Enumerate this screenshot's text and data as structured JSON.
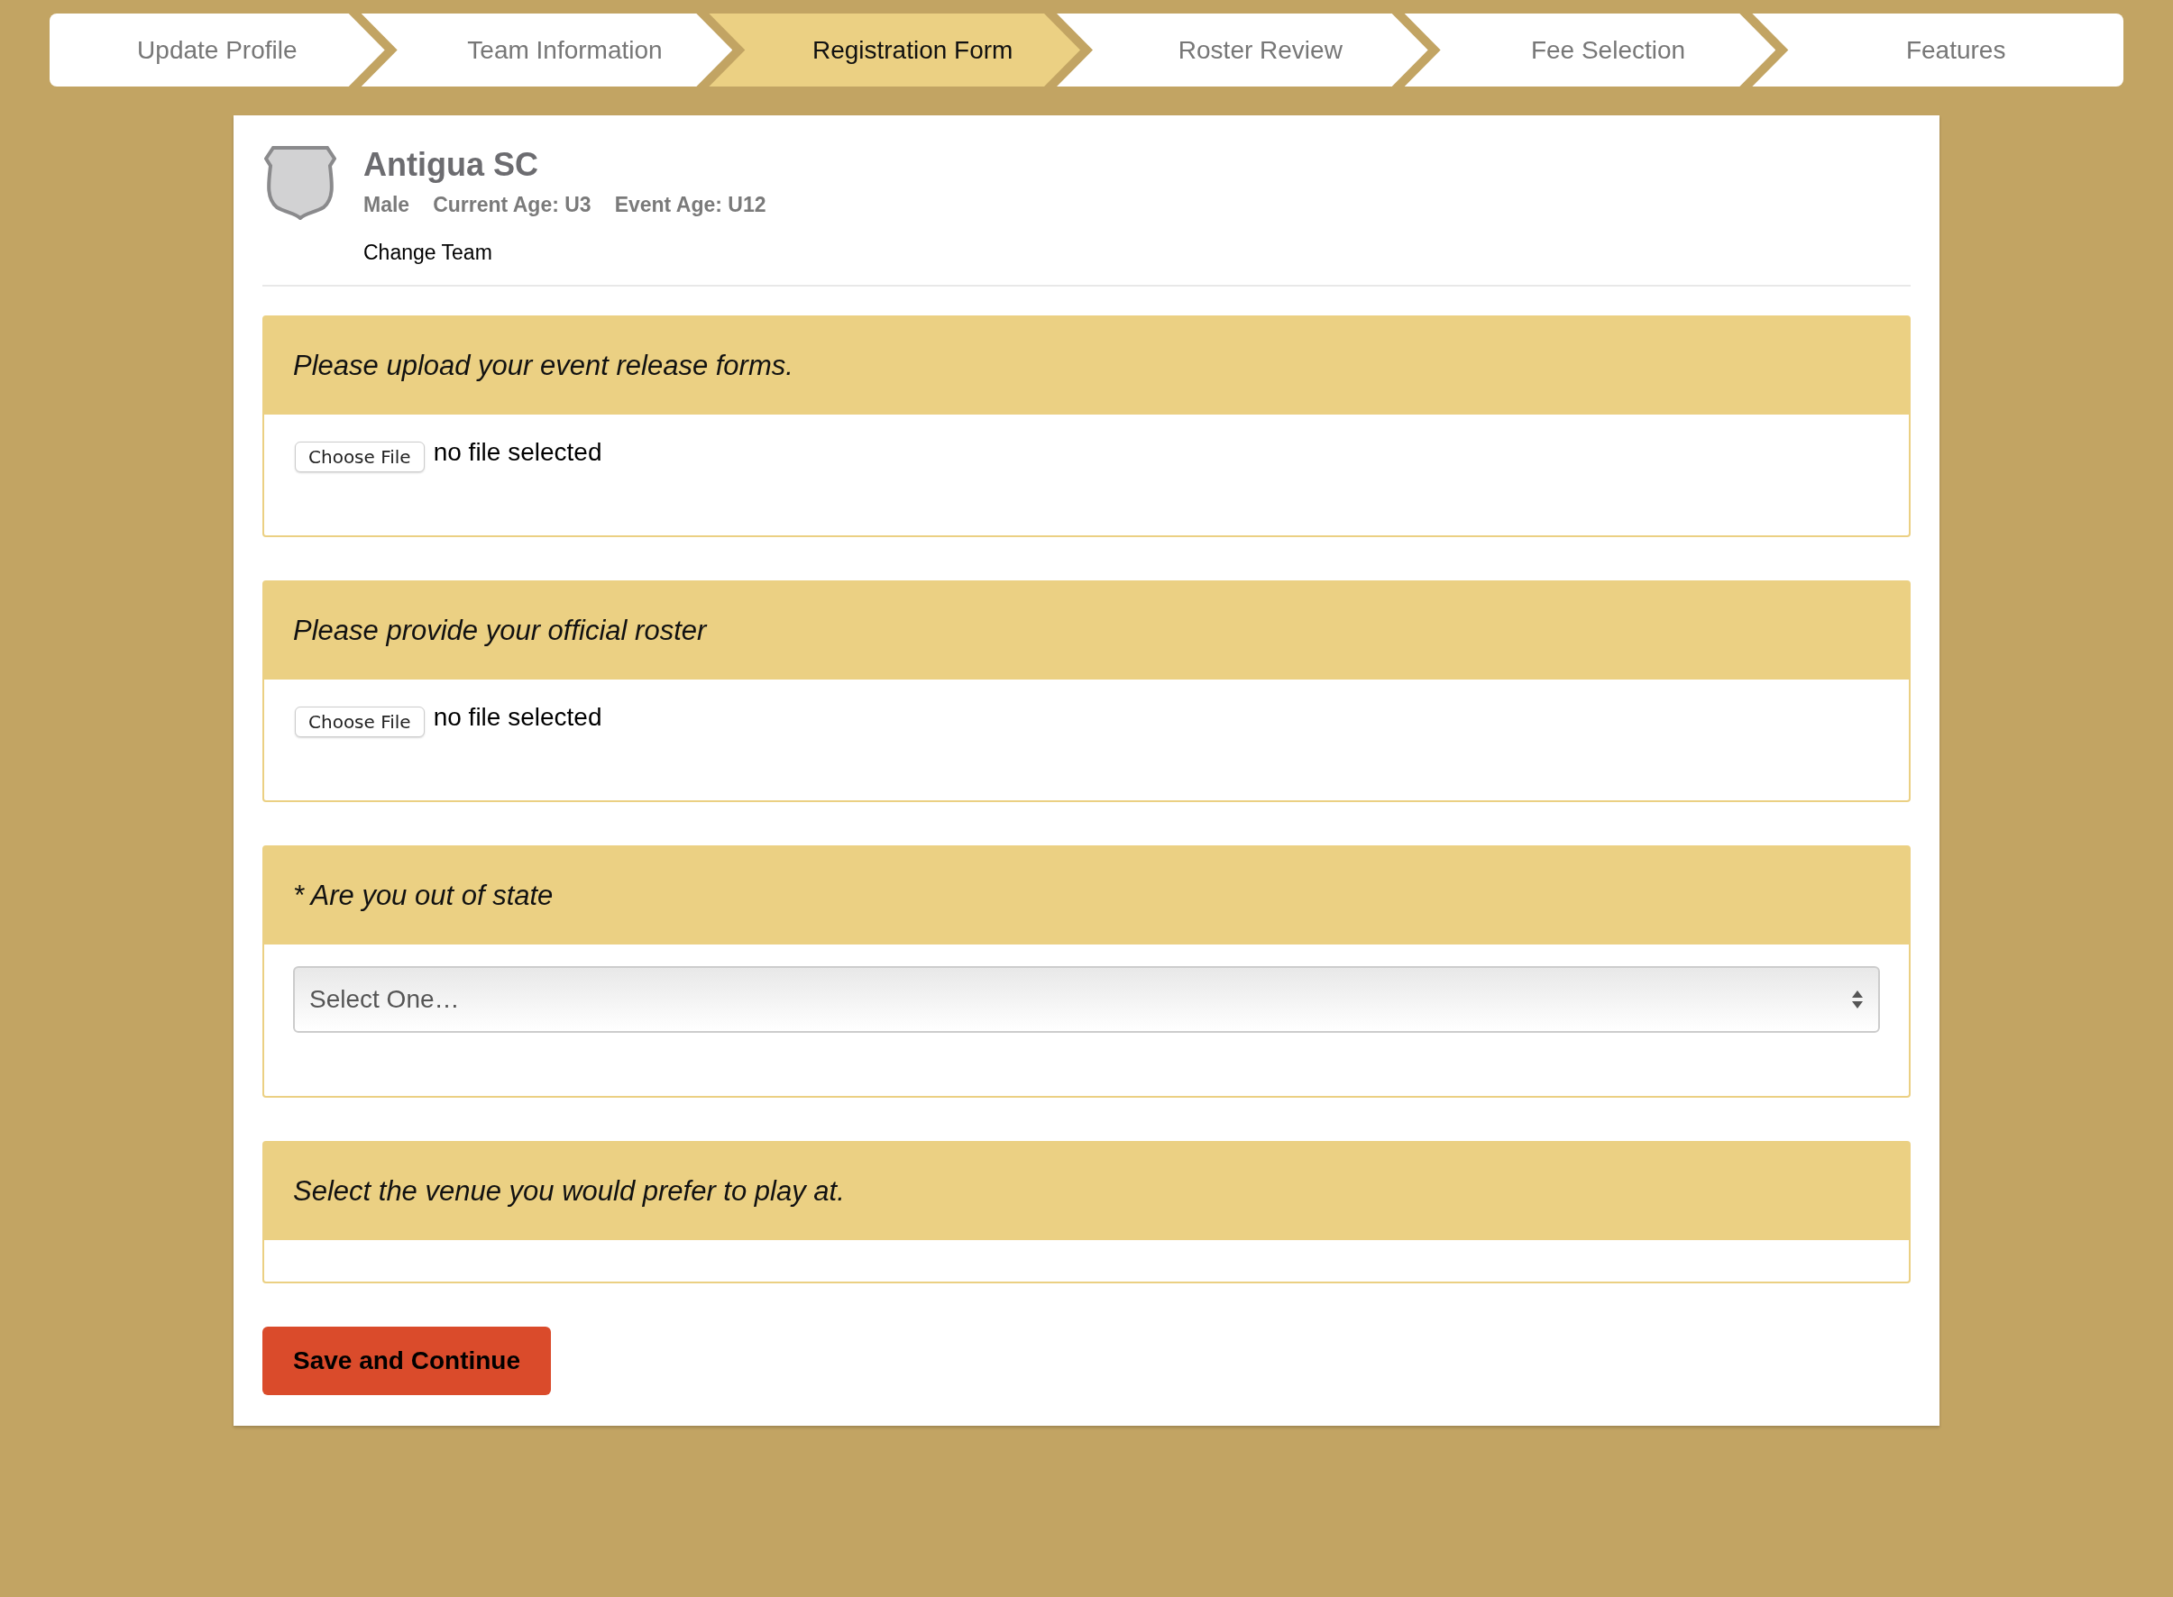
{
  "steps": [
    {
      "label": "Update Profile",
      "selected": false
    },
    {
      "label": "Team Information",
      "selected": false
    },
    {
      "label": "Registration Form",
      "selected": true
    },
    {
      "label": "Roster Review",
      "selected": false
    },
    {
      "label": "Fee Selection",
      "selected": false
    },
    {
      "label": "Features",
      "selected": false
    }
  ],
  "team": {
    "name": "Antigua SC",
    "gender": "Male",
    "current_age": "Current Age: U3",
    "event_age": "Event Age: U12",
    "change_link": "Change Team"
  },
  "panels": [
    {
      "kind": "file",
      "title": "Please upload your event release forms.",
      "button": "Choose File",
      "status": "no file selected"
    },
    {
      "kind": "file",
      "title": "Please provide your official roster",
      "button": "Choose File",
      "status": "no file selected"
    },
    {
      "kind": "select",
      "title": "* Are you out of state",
      "placeholder": "Select One…"
    },
    {
      "kind": "empty",
      "title": "Select the venue you would prefer to play at."
    }
  ],
  "save_button": "Save and Continue"
}
